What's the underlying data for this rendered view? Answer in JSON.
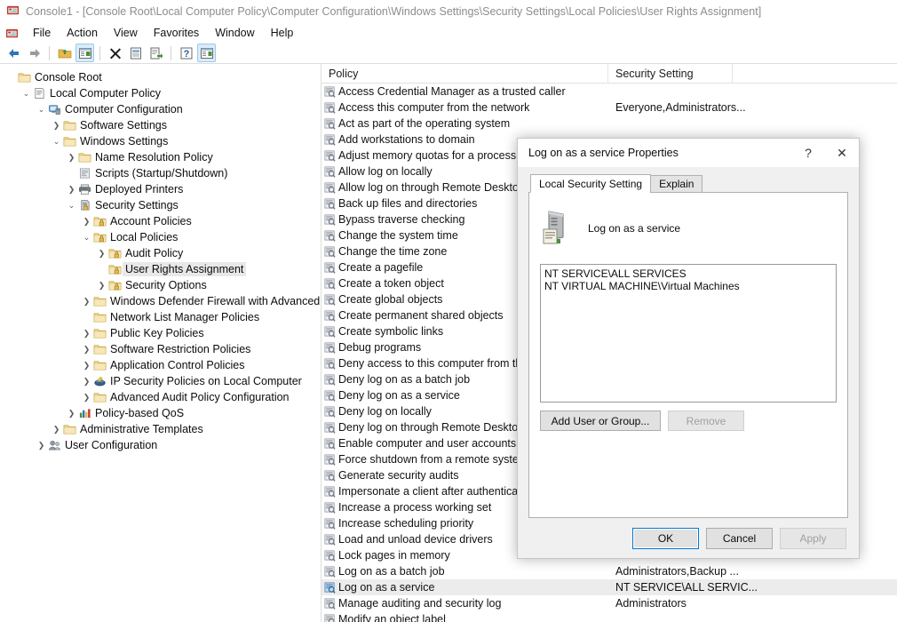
{
  "window": {
    "title": "Console1 - [Console Root\\Local Computer Policy\\Computer Configuration\\Windows Settings\\Security Settings\\Local Policies\\User Rights Assignment]",
    "app_icon": "mmc-console-icon"
  },
  "menu": {
    "items": [
      {
        "label": "File"
      },
      {
        "label": "Action"
      },
      {
        "label": "View"
      },
      {
        "label": "Favorites"
      },
      {
        "label": "Window"
      },
      {
        "label": "Help"
      }
    ]
  },
  "toolbar": {
    "buttons": [
      {
        "name": "back-arrow-icon",
        "active": false
      },
      {
        "name": "forward-arrow-icon",
        "active": false
      },
      {
        "name": "up-folder-icon",
        "active": false
      },
      {
        "name": "show-hide-tree-icon",
        "active": true
      },
      {
        "name": "delete-icon",
        "active": false
      },
      {
        "name": "properties-icon",
        "active": false
      },
      {
        "name": "export-list-icon",
        "active": false
      },
      {
        "name": "help-icon",
        "active": false
      },
      {
        "name": "new-window-icon",
        "active": true
      }
    ]
  },
  "tree": {
    "nodes": [
      {
        "label": "Console Root",
        "indent": 0,
        "twisty": "none",
        "icon": "folder-icon",
        "selected": false
      },
      {
        "label": "Local Computer Policy",
        "indent": 1,
        "twisty": "open",
        "icon": "policy-doc-icon",
        "selected": false
      },
      {
        "label": "Computer Configuration",
        "indent": 2,
        "twisty": "open",
        "icon": "computer-icon",
        "selected": false
      },
      {
        "label": "Software Settings",
        "indent": 3,
        "twisty": "closed",
        "icon": "folder-icon",
        "selected": false
      },
      {
        "label": "Windows Settings",
        "indent": 3,
        "twisty": "open",
        "icon": "folder-icon",
        "selected": false
      },
      {
        "label": "Name Resolution Policy",
        "indent": 4,
        "twisty": "closed",
        "icon": "folder-icon",
        "selected": false
      },
      {
        "label": "Scripts (Startup/Shutdown)",
        "indent": 4,
        "twisty": "none",
        "icon": "script-icon",
        "selected": false
      },
      {
        "label": "Deployed Printers",
        "indent": 4,
        "twisty": "closed",
        "icon": "printer-icon",
        "selected": false
      },
      {
        "label": "Security Settings",
        "indent": 4,
        "twisty": "open",
        "icon": "security-icon",
        "selected": false
      },
      {
        "label": "Account Policies",
        "indent": 5,
        "twisty": "closed",
        "icon": "lock-folder-icon",
        "selected": false
      },
      {
        "label": "Local Policies",
        "indent": 5,
        "twisty": "open",
        "icon": "lock-folder-icon",
        "selected": false
      },
      {
        "label": "Audit Policy",
        "indent": 6,
        "twisty": "closed",
        "icon": "lock-folder-icon",
        "selected": false
      },
      {
        "label": "User Rights Assignment",
        "indent": 6,
        "twisty": "none",
        "icon": "lock-folder-icon",
        "selected": true
      },
      {
        "label": "Security Options",
        "indent": 6,
        "twisty": "closed",
        "icon": "lock-folder-icon",
        "selected": false
      },
      {
        "label": "Windows Defender Firewall with Advanced Security",
        "indent": 5,
        "twisty": "closed",
        "icon": "folder-icon",
        "selected": false
      },
      {
        "label": "Network List Manager Policies",
        "indent": 5,
        "twisty": "none",
        "icon": "folder-icon",
        "selected": false
      },
      {
        "label": "Public Key Policies",
        "indent": 5,
        "twisty": "closed",
        "icon": "folder-icon",
        "selected": false
      },
      {
        "label": "Software Restriction Policies",
        "indent": 5,
        "twisty": "closed",
        "icon": "folder-icon",
        "selected": false
      },
      {
        "label": "Application Control Policies",
        "indent": 5,
        "twisty": "closed",
        "icon": "folder-icon",
        "selected": false
      },
      {
        "label": "IP Security Policies on Local Computer",
        "indent": 5,
        "twisty": "closed",
        "icon": "ipsec-icon",
        "selected": false
      },
      {
        "label": "Advanced Audit Policy Configuration",
        "indent": 5,
        "twisty": "closed",
        "icon": "folder-icon",
        "selected": false
      },
      {
        "label": "Policy-based QoS",
        "indent": 4,
        "twisty": "closed",
        "icon": "qos-chart-icon",
        "selected": false
      },
      {
        "label": "Administrative Templates",
        "indent": 3,
        "twisty": "closed",
        "icon": "folder-icon",
        "selected": false
      },
      {
        "label": "User Configuration",
        "indent": 2,
        "twisty": "closed",
        "icon": "user-config-icon",
        "selected": false
      }
    ]
  },
  "list": {
    "columns": [
      {
        "label": "Policy",
        "sorted": "asc"
      },
      {
        "label": "Security Setting",
        "sorted": "none"
      }
    ],
    "rows": [
      {
        "policy": "Access Credential Manager as a trusted caller",
        "setting": "",
        "selected": false
      },
      {
        "policy": "Access this computer from the network",
        "setting": "Everyone,Administrators...",
        "selected": false
      },
      {
        "policy": "Act as part of the operating system",
        "setting": "",
        "selected": false
      },
      {
        "policy": "Add workstations to domain",
        "setting": "",
        "selected": false
      },
      {
        "policy": "Adjust memory quotas for a process",
        "setting": "",
        "selected": false
      },
      {
        "policy": "Allow log on locally",
        "setting": "",
        "selected": false
      },
      {
        "policy": "Allow log on through Remote Desktop Services",
        "setting": "",
        "selected": false
      },
      {
        "policy": "Back up files and directories",
        "setting": "",
        "selected": false
      },
      {
        "policy": "Bypass traverse checking",
        "setting": "",
        "selected": false
      },
      {
        "policy": "Change the system time",
        "setting": "",
        "selected": false
      },
      {
        "policy": "Change the time zone",
        "setting": "",
        "selected": false
      },
      {
        "policy": "Create a pagefile",
        "setting": "",
        "selected": false
      },
      {
        "policy": "Create a token object",
        "setting": "",
        "selected": false
      },
      {
        "policy": "Create global objects",
        "setting": "",
        "selected": false
      },
      {
        "policy": "Create permanent shared objects",
        "setting": "",
        "selected": false
      },
      {
        "policy": "Create symbolic links",
        "setting": "",
        "selected": false
      },
      {
        "policy": "Debug programs",
        "setting": "",
        "selected": false
      },
      {
        "policy": "Deny access to this computer from the network",
        "setting": "",
        "selected": false
      },
      {
        "policy": "Deny log on as a batch job",
        "setting": "",
        "selected": false
      },
      {
        "policy": "Deny log on as a service",
        "setting": "",
        "selected": false
      },
      {
        "policy": "Deny log on locally",
        "setting": "",
        "selected": false
      },
      {
        "policy": "Deny log on through Remote Desktop Services",
        "setting": "",
        "selected": false
      },
      {
        "policy": "Enable computer and user accounts to be trusted for delegation",
        "setting": "",
        "selected": false
      },
      {
        "policy": "Force shutdown from a remote system",
        "setting": "",
        "selected": false
      },
      {
        "policy": "Generate security audits",
        "setting": "",
        "selected": false
      },
      {
        "policy": "Impersonate a client after authentication",
        "setting": "",
        "selected": false
      },
      {
        "policy": "Increase a process working set",
        "setting": "",
        "selected": false
      },
      {
        "policy": "Increase scheduling priority",
        "setting": "",
        "selected": false
      },
      {
        "policy": "Load and unload device drivers",
        "setting": "",
        "selected": false
      },
      {
        "policy": "Lock pages in memory",
        "setting": "",
        "selected": false
      },
      {
        "policy": "Log on as a batch job",
        "setting": "Administrators,Backup ...",
        "selected": false
      },
      {
        "policy": "Log on as a service",
        "setting": "NT SERVICE\\ALL SERVIC...",
        "selected": true
      },
      {
        "policy": "Manage auditing and security log",
        "setting": "Administrators",
        "selected": false
      },
      {
        "policy": "Modify an object label",
        "setting": "",
        "selected": false
      }
    ]
  },
  "dialog": {
    "title": "Log on as a service Properties",
    "help_glyph": "?",
    "close_glyph": "✕",
    "tabs": [
      {
        "label": "Local Security Setting",
        "active": true
      },
      {
        "label": "Explain",
        "active": false
      }
    ],
    "policy_name": "Log on as a service",
    "policy_icon": "server-policy-icon",
    "assigned": [
      "NT SERVICE\\ALL SERVICES",
      "NT VIRTUAL MACHINE\\Virtual Machines"
    ],
    "add_button": "Add User or Group...",
    "remove_button": "Remove",
    "remove_disabled": true,
    "ok_button": "OK",
    "cancel_button": "Cancel",
    "apply_button": "Apply",
    "apply_disabled": true
  },
  "colors": {
    "accent": "#0078d7",
    "selection": "#ececec",
    "toolbar_active": "#d9ecfb",
    "title_text": "#8d8d8d"
  }
}
